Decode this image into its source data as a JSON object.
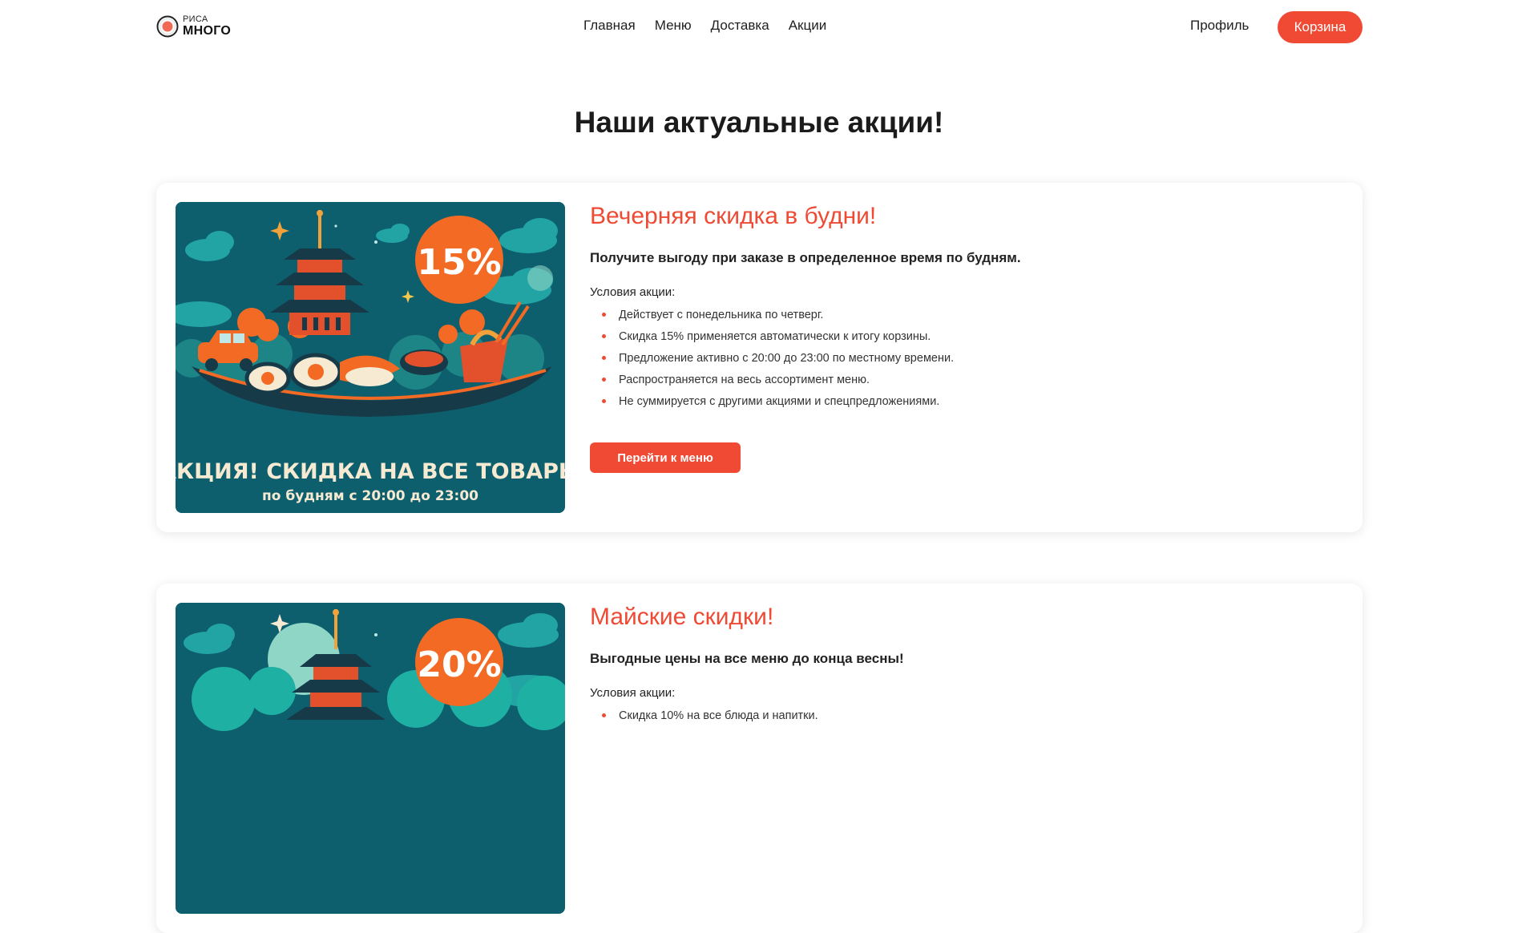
{
  "header": {
    "logo_top": "РИСА",
    "logo_bottom": "МНОГО",
    "nav": [
      "Главная",
      "Меню",
      "Доставка",
      "Акции"
    ],
    "profile": "Профиль",
    "cart": "Корзина"
  },
  "page_title": "Наши актуальные акции!",
  "colors": {
    "accent": "#f04a35",
    "banner_bg": "#0e5f6e"
  },
  "promos": [
    {
      "image": {
        "badge": "15%",
        "headline": "АКЦИЯ! СКИДКА НА ВСЕ ТОВАРЫ",
        "subline": "по будням с 20:00 до 23:00"
      },
      "title": "Вечерняя скидка в будни!",
      "subtitle": "Получите выгоду при заказе в определенное время по будням.",
      "conditions_label": "Условия акции:",
      "conditions": [
        "Действует с понедельника по четверг.",
        "Скидка 15% применяется автоматически к итогу корзины.",
        "Предложение активно с 20:00 до 23:00 по местному времени.",
        "Распространяется на весь ассортимент меню.",
        "Не суммируется с другими акциями и спецпредложениями."
      ],
      "button": "Перейти к меню"
    },
    {
      "image": {
        "badge": "20%"
      },
      "title": "Майские скидки!",
      "subtitle": "Выгодные цены на все меню до конца весны!",
      "conditions_label": "Условия акции:",
      "conditions": [
        "Скидка 10% на все блюда и напитки."
      ]
    }
  ]
}
